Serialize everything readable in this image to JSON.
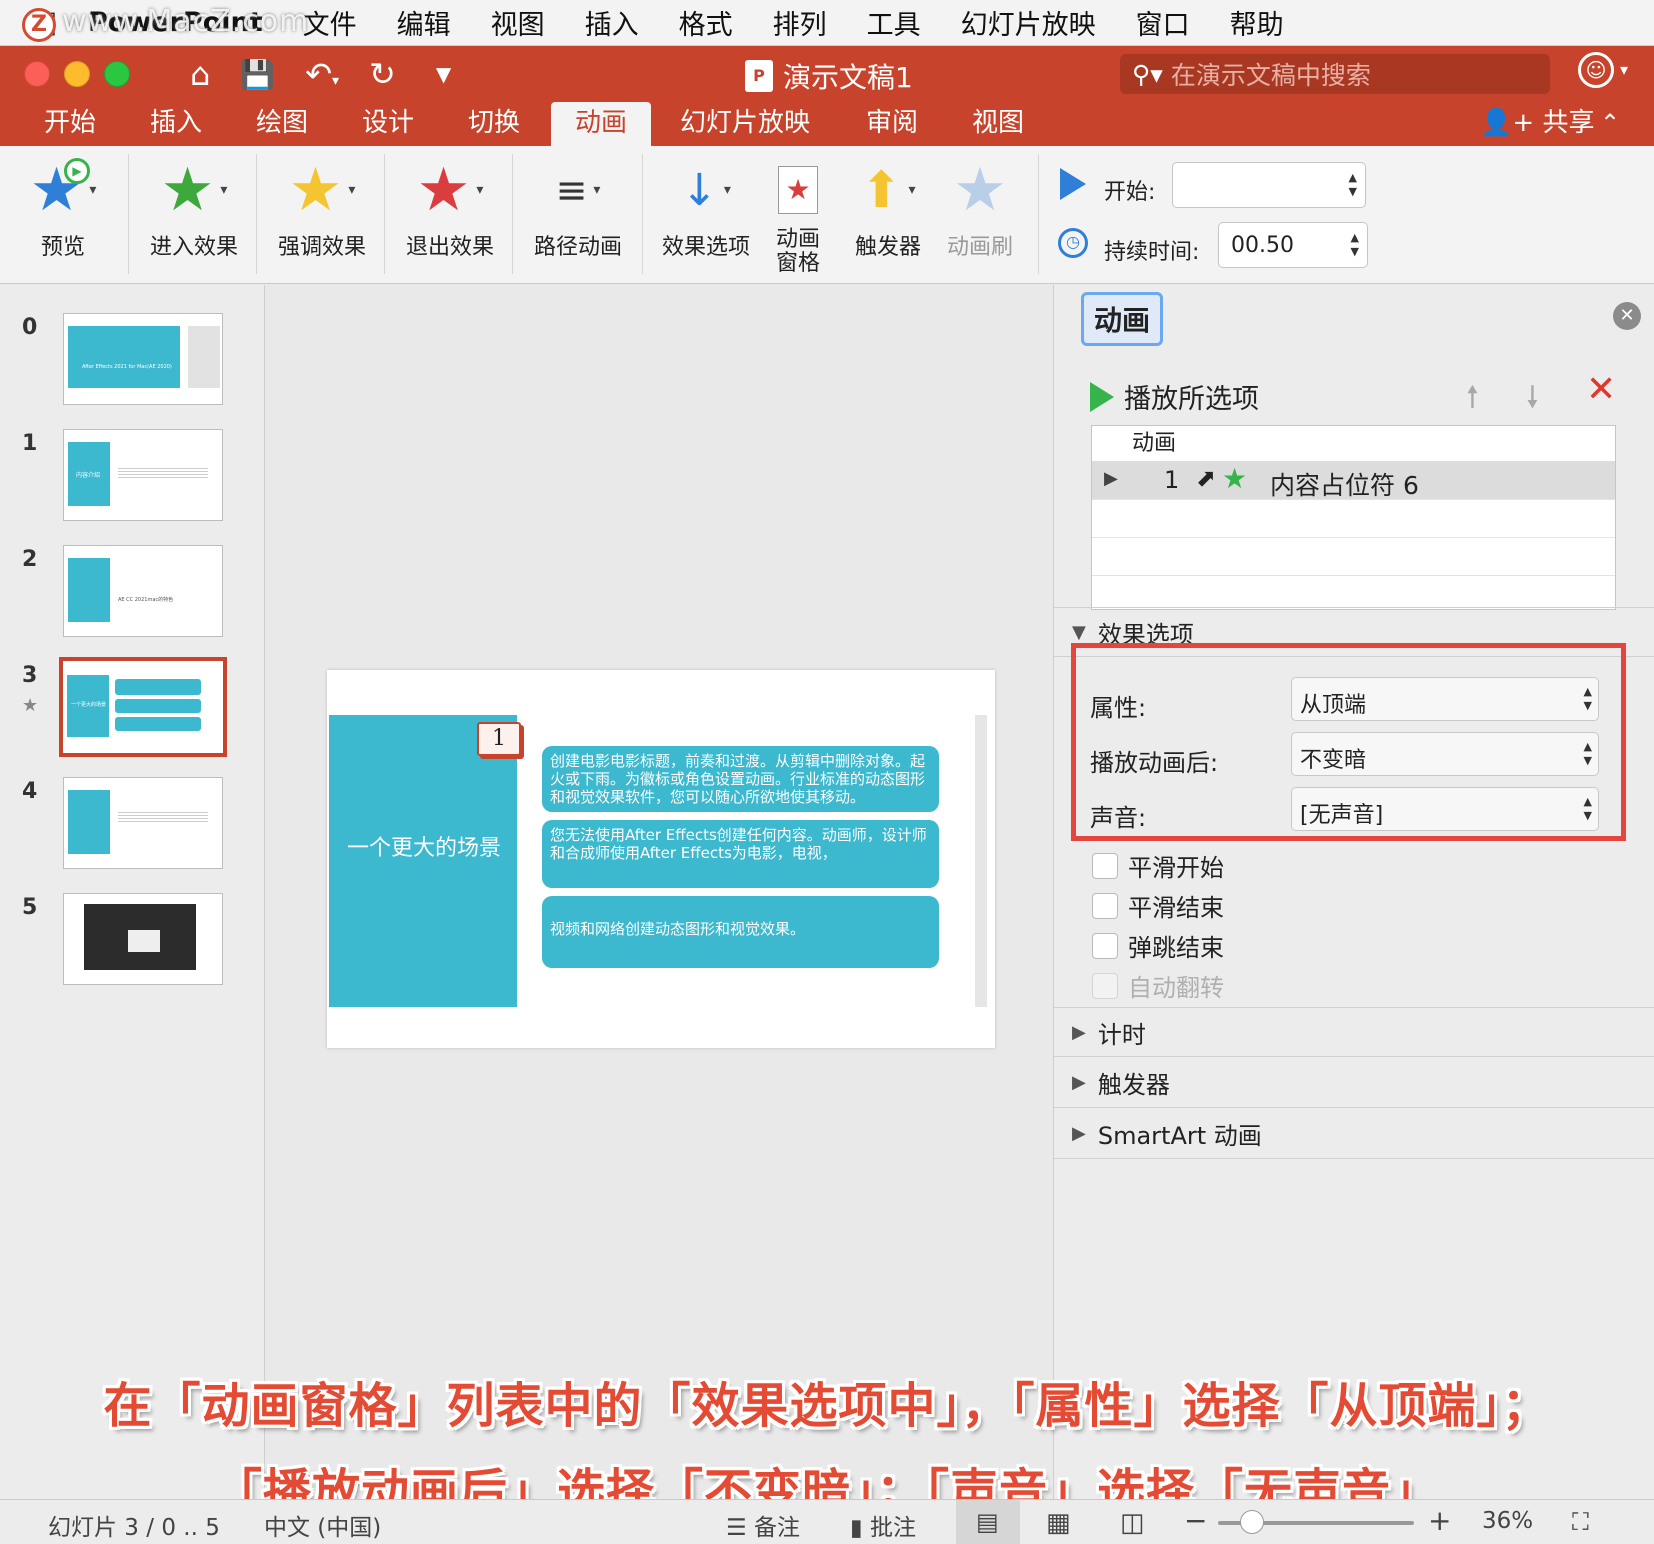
{
  "menubar": {
    "app": "PowerPoint",
    "items": [
      "文件",
      "编辑",
      "视图",
      "插入",
      "格式",
      "排列",
      "工具",
      "幻灯片放映",
      "窗口",
      "帮助"
    ],
    "watermark": "www.MacZ.com"
  },
  "titlebar": {
    "doc_title": "演示文稿1",
    "search_placeholder": "在演示文稿中搜索"
  },
  "ribbon_tabs": [
    "开始",
    "插入",
    "绘图",
    "设计",
    "切换",
    "动画",
    "幻灯片放映",
    "审阅",
    "视图"
  ],
  "active_tab": "动画",
  "share_label": "共享",
  "ribbon": {
    "preview": "预览",
    "entrance": "进入效果",
    "emphasis": "强调效果",
    "exit": "退出效果",
    "path": "路径动画",
    "effect_options": "效果选项",
    "anim_pane_1": "动画",
    "anim_pane_2": "窗格",
    "trigger": "触发器",
    "painter": "动画刷",
    "start_label": "开始:",
    "start_value": "",
    "duration_label": "持续时间:",
    "duration_value": "00.50"
  },
  "thumbnails": [
    {
      "num": "0",
      "text": "After Effects 2021 for Mac(AE 2020)"
    },
    {
      "num": "1",
      "text": "内容介绍"
    },
    {
      "num": "2",
      "text": "AE CC 2021mac的特色"
    },
    {
      "num": "3",
      "text": "一个更大的场景"
    },
    {
      "num": "4",
      "text": ""
    },
    {
      "num": "5",
      "text": ""
    }
  ],
  "slide": {
    "tag": "1",
    "title": "一个更大的场景",
    "box1": "创建电影电影标题，前奏和过渡。从剪辑中删除对象。起火或下雨。为徽标或角色设置动画。行业标准的动态图形和视觉效果软件，您可以随心所欲地使其移动。",
    "box2": "您无法使用After Effects创建任何内容。动画师，设计师和合成师使用After Effects为电影，电视，",
    "box3": "视频和网络创建动态图形和视觉效果。"
  },
  "anim_pane": {
    "title": "动画",
    "play_label": "播放所选项",
    "list_header": "动画",
    "list_rows": [
      {
        "num": "1",
        "name": "内容占位符 6"
      }
    ],
    "effect_options_label": "效果选项",
    "properties": [
      {
        "label": "属性:",
        "value": "从顶端"
      },
      {
        "label": "播放动画后:",
        "value": "不变暗"
      },
      {
        "label": "声音:",
        "value": "[无声音]"
      }
    ],
    "checkboxes": [
      {
        "label": "平滑开始",
        "enabled": true
      },
      {
        "label": "平滑结束",
        "enabled": true
      },
      {
        "label": "弹跳结束",
        "enabled": true
      },
      {
        "label": "自动翻转",
        "enabled": false
      }
    ],
    "sections": [
      "计时",
      "触发器",
      "SmartArt 动画"
    ]
  },
  "statusbar": {
    "slide_info": "幻灯片 3 / 0 .. 5",
    "language": "中文 (中国)",
    "notes": "备注",
    "comments": "批注",
    "zoom": "36%"
  },
  "captions": {
    "line1": "在「动画窗格」列表中的「效果选项中」，「属性」选择「从顶端」；",
    "line2": "「播放动画后」选择「不变暗」；「声音」选择「无声音」"
  },
  "colors": {
    "accent": "#c8432b",
    "slide_cyan": "#3cb8cf",
    "caption_red": "#e34b34",
    "highlight_box": "#e3463c"
  }
}
